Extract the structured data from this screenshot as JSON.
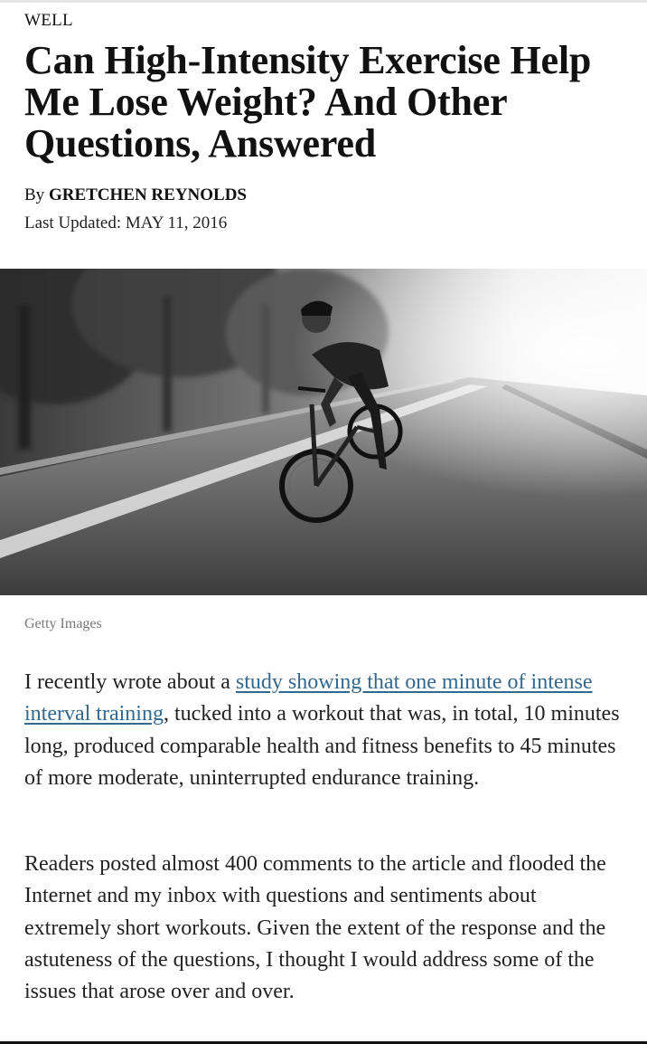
{
  "article": {
    "section": "WELL",
    "headline": "Can High-Intensity Exercise Help Me Lose Weight? And Other Questions, Answered",
    "byline_prefix": "By ",
    "author": "GRETCHEN REYNOLDS",
    "updated": "Last Updated: MAY 11, 2016",
    "image_credit": "Getty Images",
    "paragraph1": {
      "before_link": "I recently wrote about a ",
      "link_text": "study showing that one minute of intense interval training",
      "after_link": ", tucked into a workout that was, in total, 10 minutes long, produced comparable health and fitness benefits to 45 minutes of more moderate, uninterrupted endurance training."
    },
    "paragraph2": "Readers posted almost 400 comments to the article and flooded the Internet and my inbox with questions and sentiments about extremely short workouts. Given the extent of the response and the astuteness of the questions, I thought I would address some of the issues that arose over and over."
  },
  "colors": {
    "link": "#326891",
    "text": "#222222",
    "credit": "#777777"
  }
}
